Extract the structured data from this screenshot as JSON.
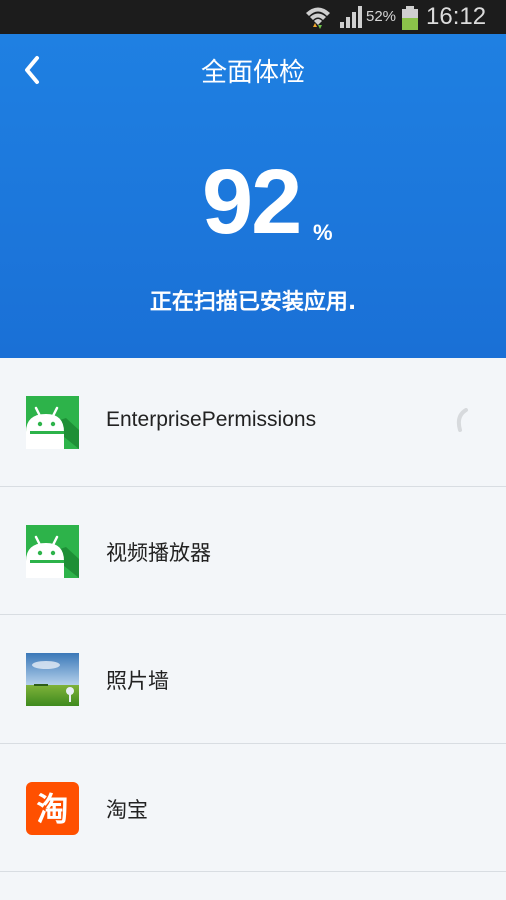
{
  "status_bar": {
    "battery_percent": "52%",
    "time": "16:12",
    "icons": [
      "wifi-icon",
      "signal-icon",
      "battery-icon"
    ]
  },
  "header": {
    "title": "全面体检",
    "score": "92",
    "score_unit": "%",
    "status": "正在扫描已安装应用."
  },
  "apps": [
    {
      "name": "EnterprisePermissions",
      "icon": "android-app-icon",
      "scanning": true
    },
    {
      "name": "视频播放器",
      "icon": "android-app-icon",
      "scanning": false
    },
    {
      "name": "照片墙",
      "icon": "landscape-photo-icon",
      "scanning": false
    },
    {
      "name": "淘宝",
      "icon": "taobao-icon",
      "icon_text": "淘",
      "scanning": false
    }
  ],
  "colors": {
    "header_blue": "#1a73d9",
    "android_green": "#2db34a",
    "taobao_orange": "#ff5000",
    "list_bg": "#f3f6f9"
  }
}
